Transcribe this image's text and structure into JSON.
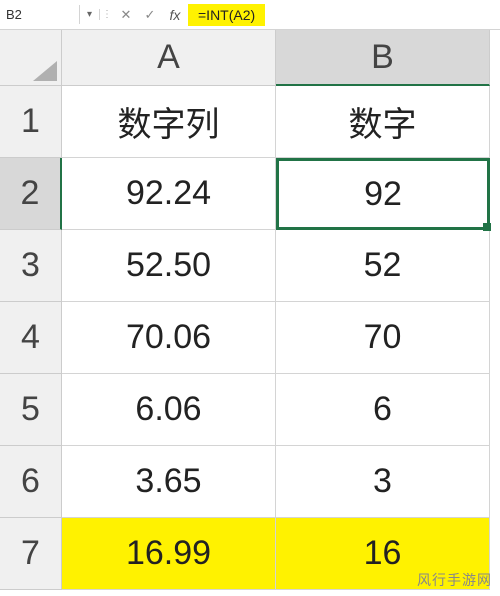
{
  "formula_bar": {
    "cell_ref": "B2",
    "dropdown_glyph": "▾",
    "separator_glyph": "⋮",
    "cancel_glyph": "✕",
    "confirm_glyph": "✓",
    "fx_label": "fx",
    "formula": "=INT(A2)"
  },
  "columns": [
    "A",
    "B"
  ],
  "rows": [
    "1",
    "2",
    "3",
    "4",
    "5",
    "6",
    "7"
  ],
  "cells": {
    "A1": "数字列",
    "B1": "数字",
    "A2": "92.24",
    "B2": "92",
    "A3": "52.50",
    "B3": "52",
    "A4": "70.06",
    "B4": "70",
    "A5": "6.06",
    "B5": "6",
    "A6": "3.65",
    "B6": "3",
    "A7": "16.99",
    "B7": "16"
  },
  "selected_cell": "B2",
  "watermark": "风行手游网"
}
